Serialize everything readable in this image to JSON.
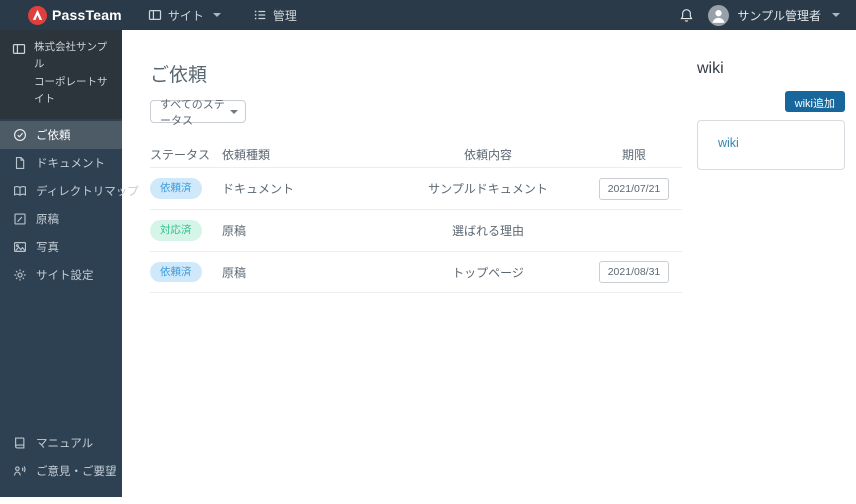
{
  "topbar": {
    "brand": "PassTeam",
    "menu_site": "サイト",
    "menu_admin": "管理",
    "user_name": "サンプル管理者"
  },
  "sidebar": {
    "site_line1": "株式会社サンプル",
    "site_line2": "コーポレートサイト",
    "items": [
      {
        "label": "ご依頼",
        "icon": "check-circle-icon",
        "active": true
      },
      {
        "label": "ドキュメント",
        "icon": "document-icon",
        "active": false
      },
      {
        "label": "ディレクトリマップ",
        "icon": "map-icon",
        "active": false
      },
      {
        "label": "原稿",
        "icon": "draft-icon",
        "active": false
      },
      {
        "label": "写真",
        "icon": "photo-icon",
        "active": false
      },
      {
        "label": "サイト設定",
        "icon": "gear-icon",
        "active": false
      }
    ],
    "footer_items": [
      {
        "label": "マニュアル",
        "icon": "manual-icon"
      },
      {
        "label": "ご意見・ご要望",
        "icon": "feedback-icon"
      }
    ]
  },
  "main": {
    "title": "ご依頼",
    "status_filter": {
      "value": "すべてのステータス"
    },
    "table": {
      "headers": [
        "ステータス",
        "依頼種類",
        "依頼内容",
        "期限"
      ],
      "rows": [
        {
          "status": "依頼済",
          "status_color": "blue",
          "type": "ドキュメント",
          "content": "サンプルドキュメント",
          "due": "2021/07/21"
        },
        {
          "status": "対応済",
          "status_color": "green",
          "type": "原稿",
          "content": "選ばれる理由",
          "due": ""
        },
        {
          "status": "依頼済",
          "status_color": "blue",
          "type": "原稿",
          "content": "トップページ",
          "due": "2021/08/31"
        }
      ]
    }
  },
  "wiki_panel": {
    "title": "wiki",
    "add_button_label": "wiki追加",
    "items": [
      {
        "label": "wiki"
      }
    ]
  },
  "colors": {
    "topbar_bg": "#2b3a48",
    "sidebar_bg": "#2e4153",
    "sidebar_active_bg": "#4d5b66",
    "site_block_bg": "#2d353c",
    "logo_red": "#e0403d",
    "badge_blue_bg": "#cfe8fa",
    "badge_blue_text": "#3a9bdc",
    "badge_green_bg": "#d5f5e8",
    "badge_green_text": "#2fbf8f",
    "wiki_button_bg": "#17669c",
    "wiki_link_text": "#3585b3"
  }
}
